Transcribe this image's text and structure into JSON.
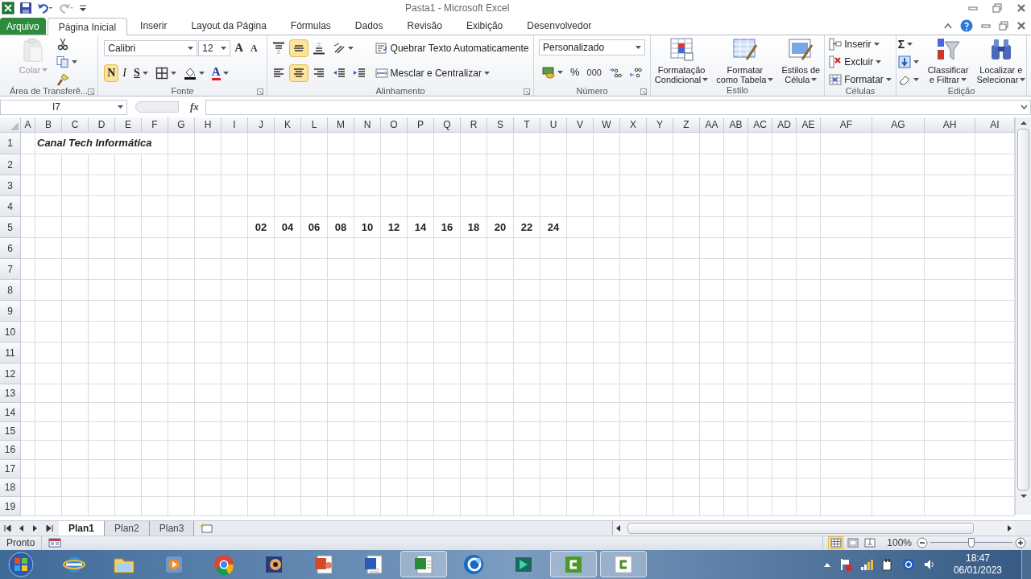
{
  "window": {
    "title": "Pasta1 - Microsoft Excel"
  },
  "ribbon_tabs": [
    {
      "label": "Arquivo",
      "kind": "file",
      "selected": false
    },
    {
      "label": "Página Inicial",
      "kind": "tab",
      "selected": true
    },
    {
      "label": "Inserir",
      "kind": "tab",
      "selected": false
    },
    {
      "label": "Layout da Página",
      "kind": "tab",
      "selected": false
    },
    {
      "label": "Fórmulas",
      "kind": "tab",
      "selected": false
    },
    {
      "label": "Dados",
      "kind": "tab",
      "selected": false
    },
    {
      "label": "Revisão",
      "kind": "tab",
      "selected": false
    },
    {
      "label": "Exibição",
      "kind": "tab",
      "selected": false
    },
    {
      "label": "Desenvolvedor",
      "kind": "tab",
      "selected": false
    }
  ],
  "ribbon_groups": [
    {
      "label": "Área de Transferê...",
      "launcher": true,
      "columns": [
        {
          "kind": "paste",
          "label_lines": [
            "Colar"
          ],
          "dropdown": true,
          "disabled": true
        },
        {
          "kind": "stack",
          "lines": [
            [
              {
                "kind": "cut",
                "dropdown": false,
                "on": false
              }
            ],
            [
              {
                "kind": "copy",
                "dropdown": true,
                "on": false
              }
            ],
            [
              {
                "kind": "painter",
                "dropdown": false,
                "on": false
              }
            ]
          ]
        }
      ]
    },
    {
      "label": "Fonte",
      "launcher": true,
      "columns": [
        {
          "kind": "stack",
          "lines": [
            [
              {
                "kind": "select",
                "value": "Calibri",
                "dropdown": true,
                "on": false
              },
              {
                "kind": "select",
                "value": "12",
                "dropdown": true,
                "on": false
              },
              {
                "kind": "grow",
                "label": "A",
                "dropdown": false,
                "on": false
              },
              {
                "kind": "shrink",
                "label": "A",
                "dropdown": false,
                "on": false
              }
            ],
            [
              {
                "kind": "bold",
                "label": "N",
                "dropdown": false,
                "on": true
              },
              {
                "kind": "italic",
                "label": "I",
                "dropdown": false,
                "on": false
              },
              {
                "kind": "underline",
                "label": "S",
                "dropdown": true,
                "on": false
              },
              {
                "kind": "borders",
                "dropdown": true,
                "on": false
              },
              {
                "kind": "fill",
                "dropdown": true,
                "on": false
              },
              {
                "kind": "fontcolor",
                "label": "A",
                "dropdown": true,
                "on": false
              }
            ]
          ]
        }
      ]
    },
    {
      "label": "Alinhamento",
      "launcher": true,
      "columns": [
        {
          "kind": "stack",
          "lines": [
            [
              {
                "kind": "align-top",
                "dropdown": false,
                "on": false
              },
              {
                "kind": "align-middle",
                "dropdown": false,
                "on": true
              },
              {
                "kind": "align-bottom",
                "dropdown": false,
                "on": false
              },
              {
                "kind": "orientation",
                "dropdown": true,
                "on": false
              }
            ],
            [
              {
                "kind": "align-left",
                "dropdown": false,
                "on": false
              },
              {
                "kind": "align-center",
                "dropdown": false,
                "on": true
              },
              {
                "kind": "align-right",
                "dropdown": false,
                "on": false
              },
              {
                "kind": "indent-dec",
                "dropdown": false,
                "on": false
              },
              {
                "kind": "indent-inc",
                "dropdown": false,
                "on": false
              }
            ]
          ]
        },
        {
          "kind": "stack",
          "lines": [
            [
              {
                "kind": "wrap",
                "label": "Quebrar Texto Automaticamente",
                "dropdown": false,
                "on": false
              }
            ],
            [
              {
                "kind": "merge",
                "label": "Mesclar e Centralizar",
                "dropdown": true,
                "on": false
              }
            ]
          ]
        }
      ]
    },
    {
      "label": "Número",
      "launcher": true,
      "columns": [
        {
          "kind": "stack",
          "lines": [
            [
              {
                "kind": "select",
                "value": "Personalizado",
                "dropdown": true,
                "on": false
              }
            ],
            [
              {
                "kind": "currency",
                "dropdown": true,
                "on": false
              },
              {
                "kind": "percent",
                "label": "%",
                "dropdown": false,
                "on": false
              },
              {
                "kind": "thousands",
                "label": "000",
                "dropdown": false,
                "on": false
              },
              {
                "kind": "inc-decimal",
                "dropdown": false,
                "on": false
              },
              {
                "kind": "dec-decimal",
                "dropdown": false,
                "on": false
              }
            ]
          ]
        }
      ]
    },
    {
      "label": "Estilo",
      "launcher": false,
      "columns": [
        {
          "kind": "conditional",
          "label_lines": [
            "Formatação",
            "Condicional"
          ],
          "dropdown": true,
          "disabled": false
        },
        {
          "kind": "table",
          "label_lines": [
            "Formatar",
            "como Tabela"
          ],
          "dropdown": true,
          "disabled": false
        },
        {
          "kind": "styles",
          "label_lines": [
            "Estilos de",
            "Célula"
          ],
          "dropdown": true,
          "disabled": false
        }
      ]
    },
    {
      "label": "Células",
      "launcher": false,
      "columns": [
        {
          "kind": "stack",
          "lines": [
            [
              {
                "kind": "insert-cells",
                "label": "Inserir",
                "dropdown": true,
                "on": false
              }
            ],
            [
              {
                "kind": "delete-cells",
                "label": "Excluir",
                "dropdown": true,
                "on": false
              }
            ],
            [
              {
                "kind": "format-cells",
                "label": "Formatar",
                "dropdown": true,
                "on": false
              }
            ]
          ]
        }
      ]
    },
    {
      "label": "Edição",
      "launcher": false,
      "columns": [
        {
          "kind": "stack",
          "lines": [
            [
              {
                "kind": "autosum",
                "label": "Σ",
                "dropdown": true,
                "on": false
              }
            ],
            [
              {
                "kind": "fill-down",
                "dropdown": true,
                "on": false
              }
            ],
            [
              {
                "kind": "clear",
                "dropdown": true,
                "on": false
              }
            ]
          ]
        },
        {
          "kind": "sort",
          "label_lines": [
            "Classificar",
            "e Filtrar"
          ],
          "dropdown": true,
          "disabled": false
        },
        {
          "kind": "find",
          "label_lines": [
            "Localizar e",
            "Selecionar"
          ],
          "dropdown": true,
          "disabled": false
        }
      ]
    }
  ],
  "formula_bar": {
    "name_box": "I7",
    "function_button": "fx"
  },
  "sheet": {
    "columns": [
      "A",
      "B",
      "C",
      "D",
      "E",
      "F",
      "G",
      "H",
      "I",
      "J",
      "K",
      "L",
      "M",
      "N",
      "O",
      "P",
      "Q",
      "R",
      "S",
      "T",
      "U",
      "V",
      "W",
      "X",
      "Y",
      "Z",
      "AA",
      "AB",
      "AC",
      "AD",
      "AE",
      "AF",
      "AG",
      "AH",
      "AI"
    ],
    "rows": [
      {
        "label": "1",
        "bold": true,
        "italic": true,
        "cells": [
          "",
          "Canal Tech Informática"
        ]
      },
      {
        "label": "2"
      },
      {
        "label": "3"
      },
      {
        "label": "4"
      },
      {
        "label": "5",
        "bold": true,
        "italic": false,
        "cells": [
          "",
          "",
          "",
          "",
          "",
          "",
          "",
          "",
          "",
          "02",
          "04",
          "06",
          "08",
          "10",
          "12",
          "14",
          "16",
          "18",
          "20",
          "22",
          "24"
        ]
      },
      {
        "label": "6"
      },
      {
        "label": "7"
      },
      {
        "label": "8"
      },
      {
        "label": "9"
      },
      {
        "label": "10"
      },
      {
        "label": "11"
      },
      {
        "label": "12"
      },
      {
        "label": "13"
      },
      {
        "label": "14"
      },
      {
        "label": "15"
      },
      {
        "label": "16"
      },
      {
        "label": "17"
      },
      {
        "label": "18"
      },
      {
        "label": "19"
      }
    ]
  },
  "sheet_tabs": [
    {
      "label": "Plan1",
      "selected": true
    },
    {
      "label": "Plan2",
      "selected": false
    },
    {
      "label": "Plan3",
      "selected": false
    }
  ],
  "status_bar": {
    "status": "Pronto",
    "views": [
      {
        "kind": "normal",
        "selected": true
      },
      {
        "kind": "page-layout",
        "selected": false
      },
      {
        "kind": "page-break",
        "selected": false
      }
    ],
    "zoom": "100%",
    "zoom_slider": {
      "level": 0.5
    }
  },
  "taskbar": {
    "apps": [
      {
        "kind": "ie",
        "running": false
      },
      {
        "kind": "folder",
        "running": false
      },
      {
        "kind": "media",
        "running": false
      },
      {
        "kind": "chrome",
        "running": false
      },
      {
        "kind": "viewer",
        "running": false
      },
      {
        "kind": "powerpoint",
        "running": false
      },
      {
        "kind": "word",
        "running": false
      },
      {
        "kind": "excel",
        "running": true
      },
      {
        "kind": "remote",
        "running": false
      },
      {
        "kind": "recorder",
        "running": false
      },
      {
        "kind": "camtasia",
        "running": true
      },
      {
        "kind": "camtasia-light",
        "running": true
      }
    ],
    "time": "18:47",
    "date": "06/01/2023"
  }
}
